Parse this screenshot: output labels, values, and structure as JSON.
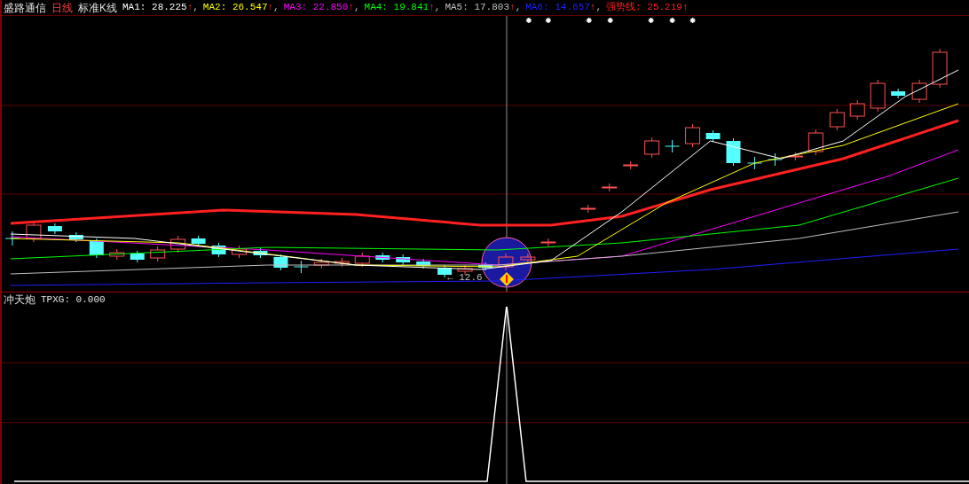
{
  "main_panel": {
    "stock_name": "盛路通信",
    "period": "日线",
    "chart_type": "标准K线",
    "indicators": [
      {
        "label": "MA1:",
        "value": "28.225",
        "arrow": "↑",
        "separator": ",",
        "color": "#ffffff"
      },
      {
        "label": "MA2:",
        "value": "26.547",
        "arrow": "↑",
        "separator": ",",
        "color": "#ffff00"
      },
      {
        "label": "MA3:",
        "value": "22.850",
        "arrow": "↑",
        "separator": ",",
        "color": "#ff00ff"
      },
      {
        "label": "MA4:",
        "value": "19.841",
        "arrow": "↑",
        "separator": ",",
        "color": "#00ff00"
      },
      {
        "label": "MA5:",
        "value": "17.803",
        "arrow": "↑",
        "separator": ",",
        "color": "#c0c0c0"
      },
      {
        "label": "MA6:",
        "value": "14.657",
        "arrow": "↑",
        "separator": ",",
        "color": "#2020ff"
      },
      {
        "label": "强势线:",
        "value": "25.219",
        "arrow": "↑",
        "color": "#ff2020"
      }
    ],
    "low_price_label": "← 12.6"
  },
  "sub_panel": {
    "title": "冲天炮",
    "indicator": "TPXG: 0.000"
  }
}
